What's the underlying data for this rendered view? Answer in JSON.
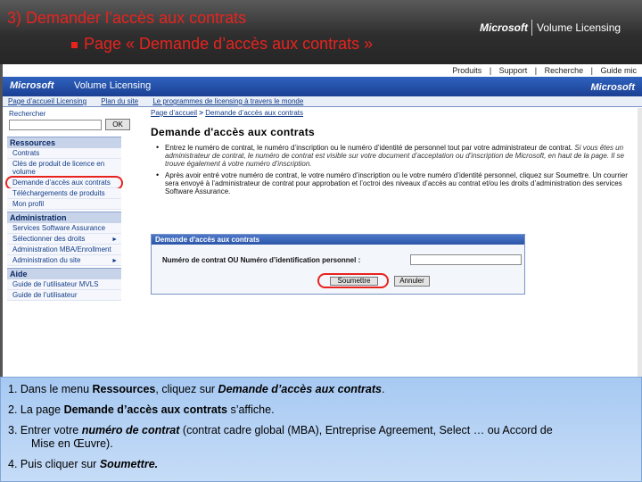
{
  "slide": {
    "title": "3) Demander l’accès aux contrats",
    "subtitle": "Page « Demande d’accès aux contrats »",
    "brand_microsoft": "Microsoft",
    "brand_product": "Volume Licensing"
  },
  "browser": {
    "top_links": [
      "Produits",
      "|",
      "Support",
      "|",
      "Recherche",
      "|",
      "Guide mic"
    ],
    "logo": "Microsoft",
    "product": "Volume Licensing",
    "logo_right": "Microsoft",
    "nav": [
      "Page d’accueil Licensing",
      "Plan du site",
      "Le programmes de licensing à travers le monde"
    ],
    "sidebar": {
      "search_label": "Rechercher",
      "go_button": "OK",
      "sections": [
        {
          "title": "Ressources",
          "items": [
            {
              "label": "Contrats"
            },
            {
              "label": "Clés de produit de licence en volume"
            },
            {
              "label": "Demande d’accès aux contrats",
              "circled": true
            },
            {
              "label": "Téléchargements de produits"
            },
            {
              "label": "Mon profil"
            }
          ]
        },
        {
          "title": "Administration",
          "items": [
            {
              "label": "Services Software Assurance"
            },
            {
              "label": "Sélectionner des droits",
              "arrow": true
            },
            {
              "label": "Administration MBA/Enrollment"
            },
            {
              "label": "Administration du site",
              "arrow": true
            }
          ]
        },
        {
          "title": "Aide",
          "items": [
            {
              "label": "Guide de l’utilisateur MVLS"
            },
            {
              "label": "Guide de l’utilisateur"
            }
          ]
        }
      ]
    },
    "main": {
      "breadcrumb": [
        "Page d’accueil",
        ">",
        "Demande d’accès aux contrats"
      ],
      "title": "Demande d'accès aux contrats",
      "bullets": [
        {
          "text": "Entrez le numéro de contrat, le numéro d’inscription ou le numéro d’identité de personnel tout par votre administrateur de contrat.",
          "italic": "Si vous êtes un administrateur de contrat, le numéro de contrat est visible sur votre document d’acceptation ou d’inscription de Microsoft, en haut de la page. Il se trouve également à votre numéro d’inscription."
        },
        {
          "text": "Après avoir entré votre numéro de contrat, le votre numéro d’inscription ou le votre numéro d’identité personnel, cliquez sur Soumettre. Un courrier sera envoyé à l’administrateur de contrat pour approbation et l’octroi des niveaux d’accès au contrat et/ou les droits d’administration des services Software Assurance.",
          "italic": ""
        }
      ],
      "form": {
        "header": "Demande d'accès aux contrats",
        "label": "Numéro de contrat OU Numéro d’identification personnel :",
        "submit": "Soumettre",
        "cancel": "Annuler"
      }
    }
  },
  "instructions": {
    "step1": {
      "a": "1. Dans le menu ",
      "b": "Ressources",
      "c": ", cliquez sur ",
      "d": "Demande d’accès aux contrats",
      "e": "."
    },
    "step2": {
      "a": "2. La page ",
      "b": "Demande d’accès aux contrats",
      "c": " s’affiche."
    },
    "step3": {
      "a": "3. Entrer votre ",
      "b": "numéro de contrat",
      "c": " (contrat cadre global (MBA), Entreprise Agreement, Select … ou Accord de",
      "d": "Mise en Œuvre)."
    },
    "step4": {
      "a": "4. Puis cliquer sur ",
      "b": "Soumettre."
    }
  }
}
